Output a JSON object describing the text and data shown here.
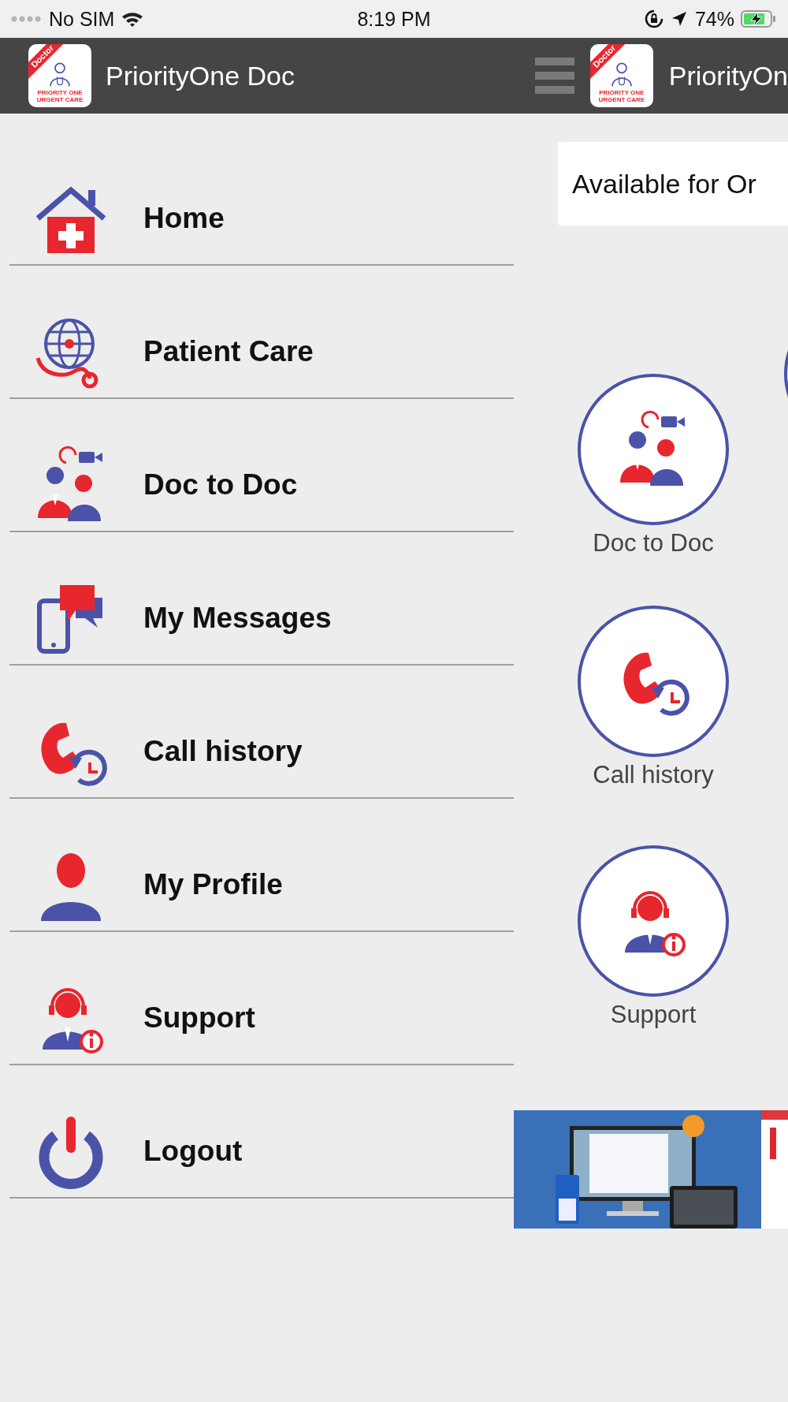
{
  "status_bar": {
    "carrier": "No SIM",
    "time": "8:19 PM",
    "battery": "74%"
  },
  "drawer": {
    "header": {
      "logo": {
        "badge": "Doctor",
        "lines": [
          "PRIORITY ONE",
          "URGENT CARE"
        ]
      },
      "title": "PriorityOne Doc"
    },
    "items": [
      {
        "label": "Home"
      },
      {
        "label": "Patient Care"
      },
      {
        "label": "Doc to Doc"
      },
      {
        "label": "My Messages"
      },
      {
        "label": "Call history"
      },
      {
        "label": "My Profile"
      },
      {
        "label": "Support"
      },
      {
        "label": "Logout"
      }
    ]
  },
  "main": {
    "header": {
      "logo": {
        "badge": "Doctor",
        "lines": [
          "PRIORITY ONE",
          "URGENT CARE"
        ]
      },
      "title": "PriorityOn"
    },
    "status_card": {
      "text": "Available for Or"
    },
    "tiles": [
      {
        "label": "Doc to Doc"
      },
      {
        "label": "Call history"
      },
      {
        "label": "Support"
      }
    ]
  }
}
